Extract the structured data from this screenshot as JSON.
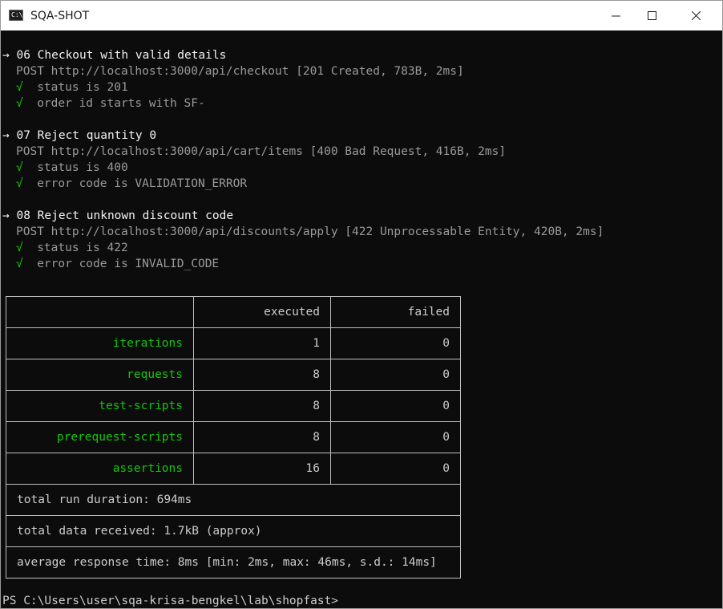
{
  "window": {
    "title": "SQA-SHOT",
    "icon": "terminal-icon",
    "icon_glyph": "C:\\",
    "controls": [
      "minimize-icon",
      "maximize-icon",
      "close-icon"
    ]
  },
  "colors": {
    "background": "#0c0c0c",
    "text": "#cccccc",
    "heading": "#f2f2f2",
    "request": "#9a9a9a",
    "pass": "#16c60c",
    "border": "#bfbfbf"
  },
  "tests": [
    {
      "heading": "→ 06 Checkout with valid details",
      "request": "POST http://localhost:3000/api/checkout [201 Created, 783B, 2ms]",
      "assertions": [
        "  status is 201",
        "  order id starts with SF-"
      ]
    },
    {
      "heading": "→ 07 Reject quantity 0",
      "request": "POST http://localhost:3000/api/cart/items [400 Bad Request, 416B, 2ms]",
      "assertions": [
        "  status is 400",
        "  error code is VALIDATION_ERROR"
      ]
    },
    {
      "heading": "→ 08 Reject unknown discount code",
      "request": "POST http://localhost:3000/api/discounts/apply [422 Unprocessable Entity, 420B, 2ms]",
      "assertions": [
        "  status is 422",
        "  error code is INVALID_CODE"
      ]
    }
  ],
  "pass_mark": "√",
  "summary": {
    "headers": [
      "",
      "executed",
      "failed"
    ],
    "rows": [
      {
        "label": "iterations",
        "executed": "1",
        "failed": "0"
      },
      {
        "label": "requests",
        "executed": "8",
        "failed": "0"
      },
      {
        "label": "test-scripts",
        "executed": "8",
        "failed": "0"
      },
      {
        "label": "prerequest-scripts",
        "executed": "8",
        "failed": "0"
      },
      {
        "label": "assertions",
        "executed": "16",
        "failed": "0"
      }
    ],
    "duration": "total run duration: 694ms",
    "data_received": "total data received: 1.7kB (approx)",
    "response_time": "average response time: 8ms [min: 2ms, max: 46ms, s.d.: 14ms]"
  },
  "prompt": "PS C:\\Users\\user\\sqa-krisa-bengkel\\lab\\shopfast> "
}
